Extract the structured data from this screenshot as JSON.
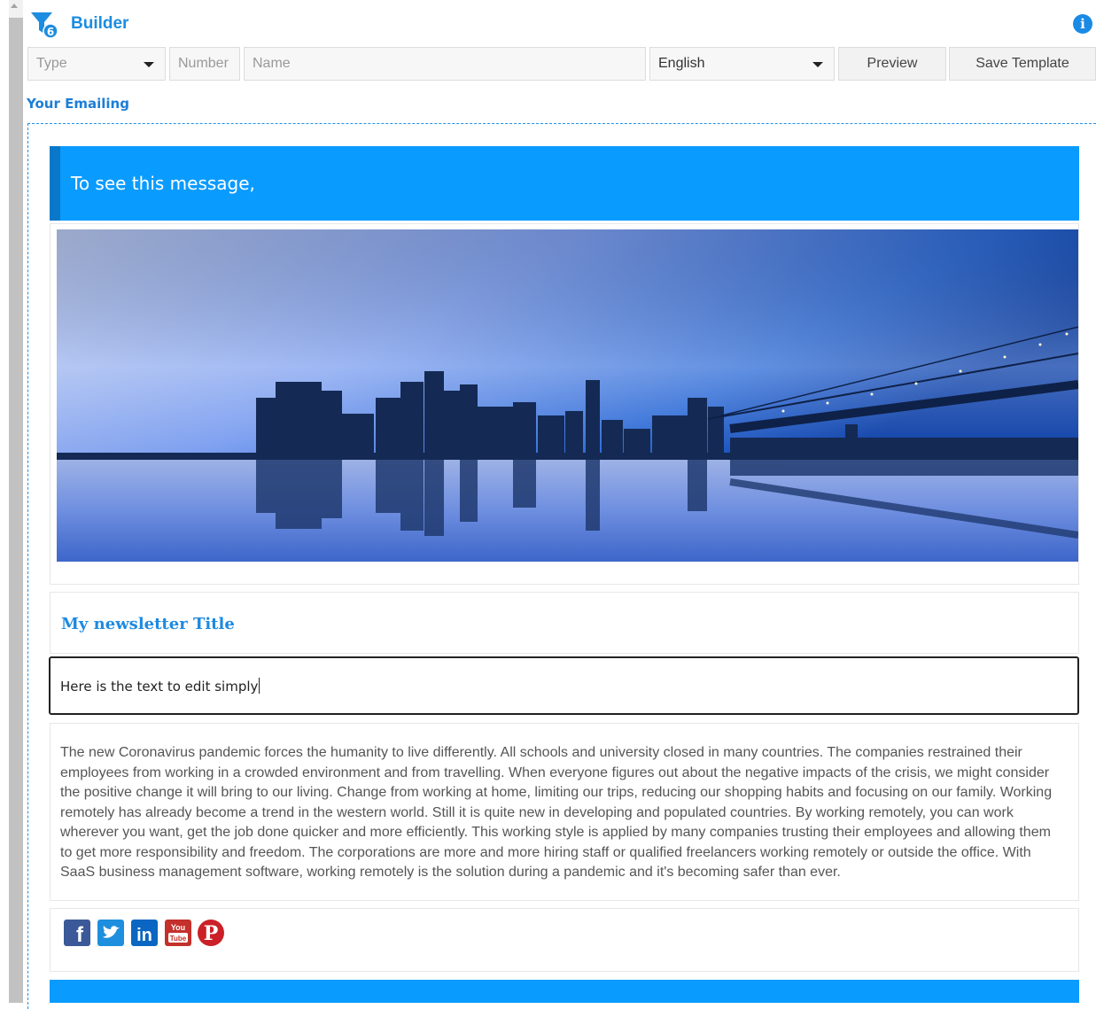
{
  "header": {
    "title": "Builder",
    "info_icon": "i"
  },
  "toolbar": {
    "type_placeholder": "Type",
    "number_placeholder": "Number",
    "name_placeholder": "Name",
    "language_value": "English",
    "preview_label": "Preview",
    "save_label": "Save Template"
  },
  "section_label": "Your Emailing",
  "email": {
    "banner_text": "To see this message,",
    "newsletter_title": "My newsletter Title",
    "edit_text": "Here is the text to edit simply",
    "body_text": "The new Coronavirus pandemic forces the humanity to live differently. All schools and university closed in many countries. The companies restrained their employees from working in a crowded environment and from travelling. When everyone figures out about the negative impacts of the crisis, we might consider the positive change it will bring to our living. Change from working at home, limiting our trips, reducing our shopping habits and focusing on our family. Working remotely has already become a trend in the western world. Still it is quite new in developing and populated countries. By working remotely, you can work wherever you want, get the job done quicker and more efficiently. This working style is applied by many companies trusting their employees and allowing them to get more responsibility and freedom. The corporations are more and more hiring staff or qualified freelancers working remotely or outside the office. With SaaS business management software, working remotely is the solution during a pandemic and it's becoming safer than ever.",
    "social_icons": [
      "facebook-icon",
      "twitter-icon",
      "linkedin-icon",
      "youtube-icon",
      "pinterest-icon"
    ],
    "social_labels": {
      "facebook": "f",
      "linkedin": "in",
      "youtube_top": "You",
      "youtube_bottom": "Tube",
      "pinterest": "P"
    }
  },
  "colors": {
    "accent": "#1c8de0",
    "banner": "#0a9bff",
    "banner_edge": "#0978c8",
    "facebook": "#3b5998",
    "twitter": "#1d8fde",
    "linkedin": "#0a66c2",
    "youtube": "#c4302b",
    "pinterest": "#cb2027"
  }
}
